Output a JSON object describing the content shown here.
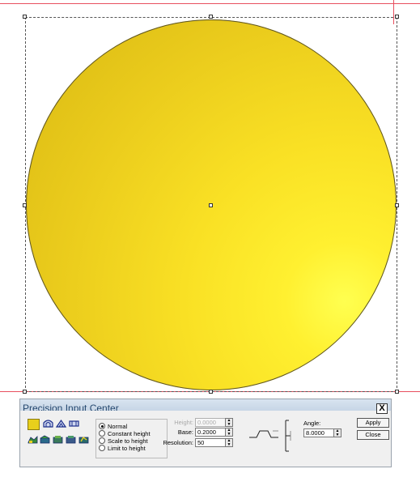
{
  "panel": {
    "title": "Precision Input Center",
    "close_glyph": "X",
    "swatch_color": "#e8cf1c",
    "modes": [
      {
        "label": "Normal",
        "selected": true
      },
      {
        "label": "Constant height",
        "selected": false
      },
      {
        "label": "Scale to height",
        "selected": false
      },
      {
        "label": "Limit to height",
        "selected": false
      }
    ],
    "height_label": "Height:",
    "height_value": "0.0000",
    "base_label": "Base:",
    "base_value": "0.2000",
    "resolution_label": "Resolution:",
    "resolution_value": "50",
    "angle_label": "Angle:",
    "angle_value": "8.0000",
    "apply_label": "Apply",
    "close_label": "Close"
  },
  "shape": {
    "fill_color": "#f2d820",
    "highlight_color": "#ffff50"
  },
  "guide_color": "#e8505f"
}
